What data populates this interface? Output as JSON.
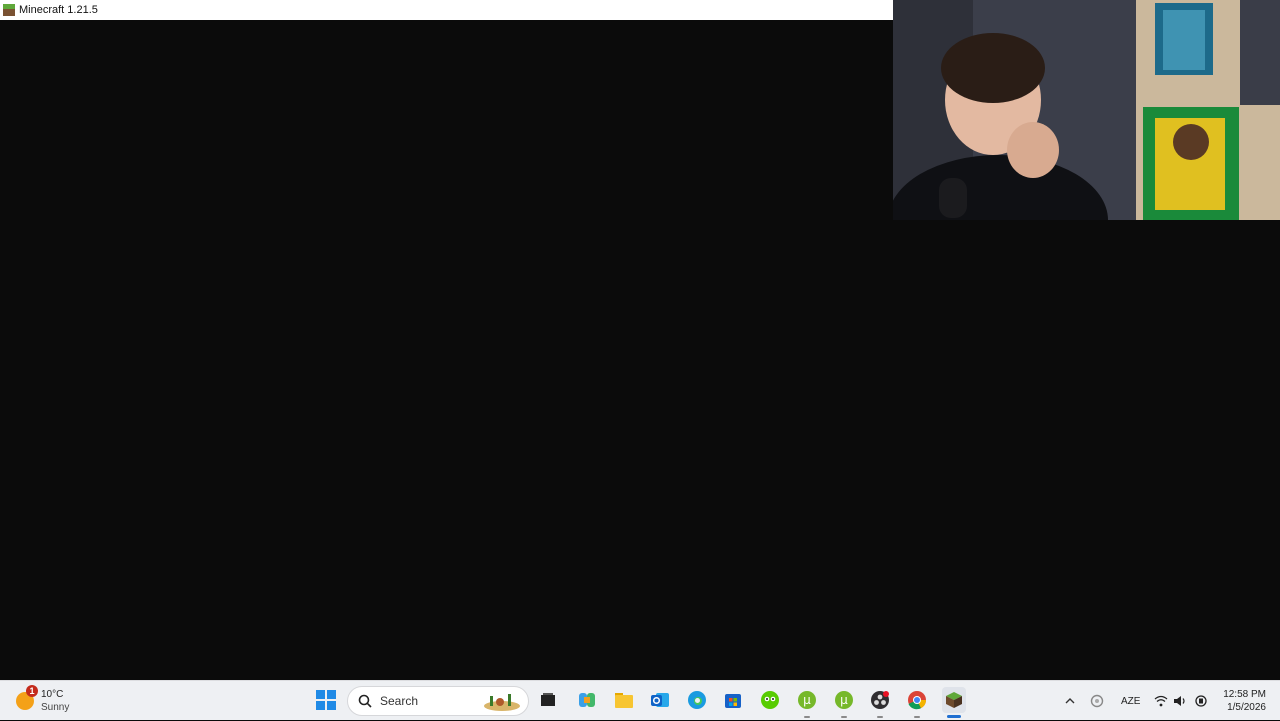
{
  "window": {
    "title": "Minecraft 1.21.5"
  },
  "taskbar": {
    "weather": {
      "temperature": "10°C",
      "condition": "Sunny",
      "badge": "1"
    },
    "search": {
      "label": "Search"
    },
    "pinned_apps": [
      "windows-start",
      "search",
      "task-view",
      "copilot",
      "file-explorer",
      "outlook",
      "edge",
      "microsoft-store",
      "duolingo",
      "utorrent",
      "utorrent",
      "obs",
      "chrome",
      "minecraft"
    ],
    "tray": {
      "language": "AZE"
    },
    "clock": {
      "time": "12:58 PM",
      "date": "1/5/2026"
    }
  },
  "colors": {
    "taskbar_bg": "#eef0f3",
    "game_bg": "#0b0b0b",
    "titlebar_bg": "#ffffff"
  }
}
